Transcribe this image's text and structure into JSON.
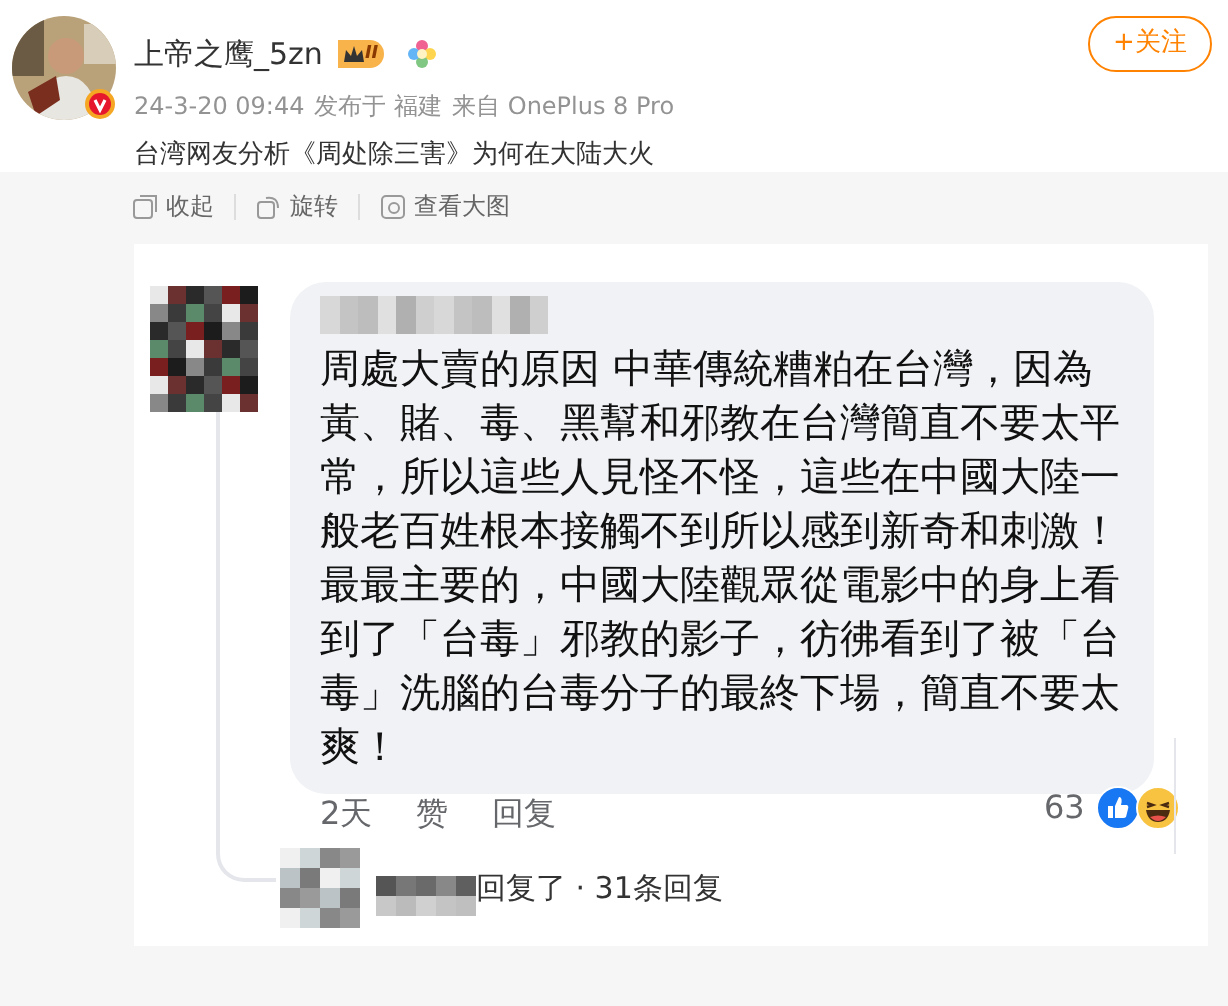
{
  "post": {
    "author": "上帝之鹰_5zn",
    "level_badge": "II",
    "verified": true,
    "follow_button": "+关注",
    "timestamp": "24-3-20 09:44",
    "location": "发布于 福建",
    "source": "来自 OnePlus 8 Pro",
    "text": "台湾网友分析《周处除三害》为何在大陆大火"
  },
  "image_toolbar": [
    "收起",
    "旋转",
    "查看大图"
  ],
  "image": {
    "comment": {
      "lines": [
        "周處大賣的原因 中華傳統糟粕在台灣，因為",
        "黃、賭、毒、黑幫和邪教在台灣簡直不要太平",
        "常，所以這些人見怪不怪，這些在中國大陸一",
        "般老百姓根本接觸不到所以感到新奇和刺激！",
        "最最主要的，中國大陸觀眾從電影中的身上看",
        "到了「台毒」邪教的影子，彷彿看到了被「台",
        "毒」洗腦的台毒分子的最終下場，簡直不要太",
        "爽！"
      ],
      "age": "2天",
      "like": "赞",
      "reply": "回复",
      "reaction_count": "63"
    },
    "reply_summary": "回复了 · 31条回复"
  }
}
